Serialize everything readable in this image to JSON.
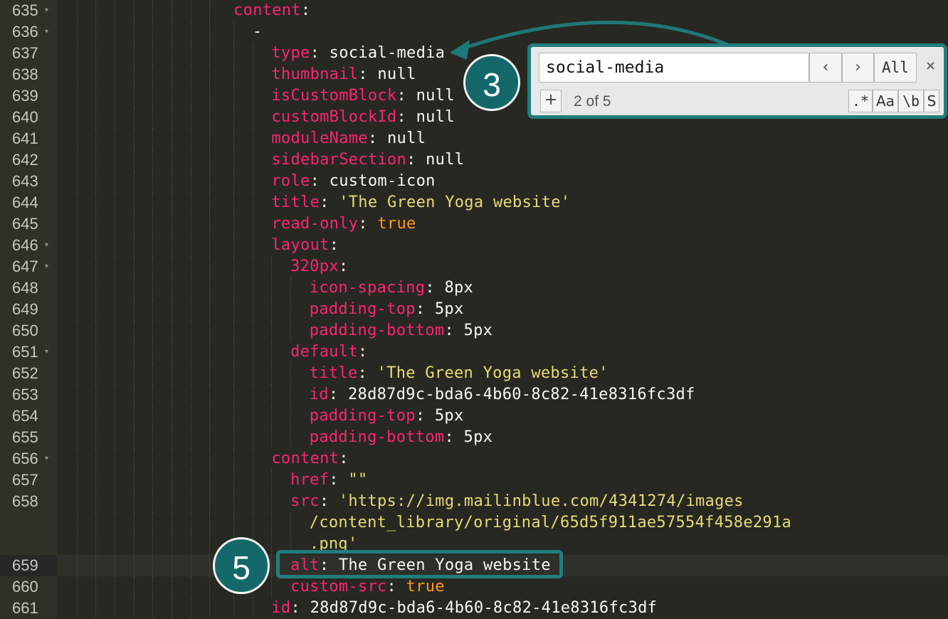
{
  "editor": {
    "lines": [
      {
        "no": "635",
        "fold": true,
        "indent": 0,
        "tokens": [
          {
            "t": "k",
            "v": "content"
          },
          {
            "t": "p",
            "v": ":"
          }
        ]
      },
      {
        "no": "636",
        "fold": true,
        "indent": 1,
        "tokens": [
          {
            "t": "p",
            "v": "-"
          }
        ]
      },
      {
        "no": "637",
        "fold": false,
        "indent": 2,
        "tokens": [
          {
            "t": "k",
            "v": "type"
          },
          {
            "t": "p",
            "v": ": "
          },
          {
            "t": "v",
            "v": "social-media"
          }
        ]
      },
      {
        "no": "638",
        "fold": false,
        "indent": 2,
        "tokens": [
          {
            "t": "k",
            "v": "thumbnail"
          },
          {
            "t": "p",
            "v": ": "
          },
          {
            "t": "v",
            "v": "null"
          }
        ]
      },
      {
        "no": "639",
        "fold": false,
        "indent": 2,
        "tokens": [
          {
            "t": "k",
            "v": "isCustomBlock"
          },
          {
            "t": "p",
            "v": ": "
          },
          {
            "t": "v",
            "v": "null"
          }
        ]
      },
      {
        "no": "640",
        "fold": false,
        "indent": 2,
        "tokens": [
          {
            "t": "k",
            "v": "customBlockId"
          },
          {
            "t": "p",
            "v": ": "
          },
          {
            "t": "v",
            "v": "null"
          }
        ]
      },
      {
        "no": "641",
        "fold": false,
        "indent": 2,
        "tokens": [
          {
            "t": "k",
            "v": "moduleName"
          },
          {
            "t": "p",
            "v": ": "
          },
          {
            "t": "v",
            "v": "null"
          }
        ]
      },
      {
        "no": "642",
        "fold": false,
        "indent": 2,
        "tokens": [
          {
            "t": "k",
            "v": "sidebarSection"
          },
          {
            "t": "p",
            "v": ": "
          },
          {
            "t": "v",
            "v": "null"
          }
        ]
      },
      {
        "no": "643",
        "fold": false,
        "indent": 2,
        "tokens": [
          {
            "t": "k",
            "v": "role"
          },
          {
            "t": "p",
            "v": ": "
          },
          {
            "t": "v",
            "v": "custom-icon"
          }
        ]
      },
      {
        "no": "644",
        "fold": false,
        "indent": 2,
        "tokens": [
          {
            "t": "k",
            "v": "title"
          },
          {
            "t": "p",
            "v": ": "
          },
          {
            "t": "s",
            "v": "'The Green Yoga website'"
          }
        ]
      },
      {
        "no": "645",
        "fold": false,
        "indent": 2,
        "tokens": [
          {
            "t": "k",
            "v": "read-only"
          },
          {
            "t": "p",
            "v": ": "
          },
          {
            "t": "b",
            "v": "true"
          }
        ]
      },
      {
        "no": "646",
        "fold": true,
        "indent": 2,
        "tokens": [
          {
            "t": "k",
            "v": "layout"
          },
          {
            "t": "p",
            "v": ":"
          }
        ]
      },
      {
        "no": "647",
        "fold": true,
        "indent": 3,
        "tokens": [
          {
            "t": "k",
            "v": "320px"
          },
          {
            "t": "p",
            "v": ":"
          }
        ]
      },
      {
        "no": "648",
        "fold": false,
        "indent": 4,
        "tokens": [
          {
            "t": "k",
            "v": "icon-spacing"
          },
          {
            "t": "p",
            "v": ": "
          },
          {
            "t": "v",
            "v": "8px"
          }
        ]
      },
      {
        "no": "649",
        "fold": false,
        "indent": 4,
        "tokens": [
          {
            "t": "k",
            "v": "padding-top"
          },
          {
            "t": "p",
            "v": ": "
          },
          {
            "t": "v",
            "v": "5px"
          }
        ]
      },
      {
        "no": "650",
        "fold": false,
        "indent": 4,
        "tokens": [
          {
            "t": "k",
            "v": "padding-bottom"
          },
          {
            "t": "p",
            "v": ": "
          },
          {
            "t": "v",
            "v": "5px"
          }
        ]
      },
      {
        "no": "651",
        "fold": true,
        "indent": 3,
        "tokens": [
          {
            "t": "k",
            "v": "default"
          },
          {
            "t": "p",
            "v": ":"
          }
        ]
      },
      {
        "no": "652",
        "fold": false,
        "indent": 4,
        "tokens": [
          {
            "t": "k",
            "v": "title"
          },
          {
            "t": "p",
            "v": ": "
          },
          {
            "t": "s",
            "v": "'The Green Yoga website'"
          }
        ]
      },
      {
        "no": "653",
        "fold": false,
        "indent": 4,
        "tokens": [
          {
            "t": "k",
            "v": "id"
          },
          {
            "t": "p",
            "v": ": "
          },
          {
            "t": "v",
            "v": "28d87d9c-bda6-4b60-8c82-41e8316fc3df"
          }
        ]
      },
      {
        "no": "654",
        "fold": false,
        "indent": 4,
        "tokens": [
          {
            "t": "k",
            "v": "padding-top"
          },
          {
            "t": "p",
            "v": ": "
          },
          {
            "t": "v",
            "v": "5px"
          }
        ]
      },
      {
        "no": "655",
        "fold": false,
        "indent": 4,
        "tokens": [
          {
            "t": "k",
            "v": "padding-bottom"
          },
          {
            "t": "p",
            "v": ": "
          },
          {
            "t": "v",
            "v": "5px"
          }
        ]
      },
      {
        "no": "656",
        "fold": true,
        "indent": 2,
        "tokens": [
          {
            "t": "k",
            "v": "content"
          },
          {
            "t": "p",
            "v": ":"
          }
        ]
      },
      {
        "no": "657",
        "fold": false,
        "indent": 3,
        "tokens": [
          {
            "t": "k",
            "v": "href"
          },
          {
            "t": "p",
            "v": ": "
          },
          {
            "t": "s",
            "v": "\"\""
          }
        ]
      },
      {
        "no": "658",
        "fold": false,
        "indent": 3,
        "tokens": [
          {
            "t": "k",
            "v": "src"
          },
          {
            "t": "p",
            "v": ": "
          },
          {
            "t": "s",
            "v": "'https://img.mailinblue.com/4341274/images"
          }
        ]
      },
      {
        "no": "",
        "fold": false,
        "indent": 4,
        "tokens": [
          {
            "t": "s",
            "v": "/content_library/original/65d5f911ae57554f458e291a"
          }
        ]
      },
      {
        "no": "",
        "fold": false,
        "indent": 4,
        "tokens": [
          {
            "t": "s",
            "v": ".png'"
          }
        ]
      },
      {
        "no": "659",
        "fold": false,
        "indent": 3,
        "active": true,
        "tokens": [
          {
            "t": "k",
            "v": "alt"
          },
          {
            "t": "p",
            "v": ": "
          },
          {
            "t": "v",
            "v": "The Green Yoga website"
          }
        ]
      },
      {
        "no": "660",
        "fold": false,
        "indent": 3,
        "tokens": [
          {
            "t": "k",
            "v": "custom-src"
          },
          {
            "t": "p",
            "v": ": "
          },
          {
            "t": "b",
            "v": "true"
          }
        ]
      },
      {
        "no": "661",
        "fold": false,
        "indent": 2,
        "tokens": [
          {
            "t": "k",
            "v": "id"
          },
          {
            "t": "p",
            "v": ": "
          },
          {
            "t": "v",
            "v": "28d87d9c-bda6-4b60-8c82-41e8316fc3df"
          }
        ]
      }
    ]
  },
  "search": {
    "query": "social-media",
    "prev_label": "‹",
    "next_label": "›",
    "all_label": "All",
    "close_label": "×",
    "add_label": "+",
    "match_count": "2 of 5",
    "regex_label": ".*",
    "case_label": "Aa",
    "word_label": "\\b",
    "selection_label": "S"
  },
  "badges": {
    "step_search": "3",
    "step_alt": "5"
  },
  "colors": {
    "background": "#272822",
    "key": "#f92672",
    "string": "#e6db74",
    "boolean": "#fd971f",
    "accent": "#217d7d"
  }
}
